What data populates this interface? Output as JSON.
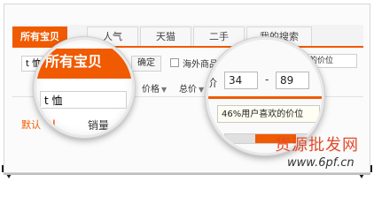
{
  "tabs": [
    {
      "label": "所有宝贝",
      "active": true
    },
    {
      "label": "人气",
      "active": false
    },
    {
      "label": "天猫",
      "active": false
    },
    {
      "label": "二手",
      "active": false
    },
    {
      "label": "我的搜索",
      "active": false
    }
  ],
  "search": {
    "query": "t 恤",
    "confirm_label": "确定",
    "overseas_label": "海外商品",
    "tooltip_label": "喜欢的价位"
  },
  "filters": [
    {
      "label": "价格"
    },
    {
      "label": "总价"
    }
  ],
  "sort": {
    "selected_label": "默认",
    "sales_label": "销量"
  },
  "lens_left": {
    "tab_label": "所有宝贝",
    "query": "t 恤",
    "sort_selected": "默认",
    "sort_sales": "销量"
  },
  "lens_right": {
    "price_label": "价",
    "price_min": "34",
    "price_max": "89",
    "range_separator": "-",
    "tooltip": "46%用户喜欢的价位",
    "user_share_percent": 46
  },
  "watermark": {
    "cn": "货源批发网",
    "url": "www.6pf.cn"
  },
  "colors": {
    "accent": "#f05a00",
    "watermark": "#e24b2a"
  }
}
